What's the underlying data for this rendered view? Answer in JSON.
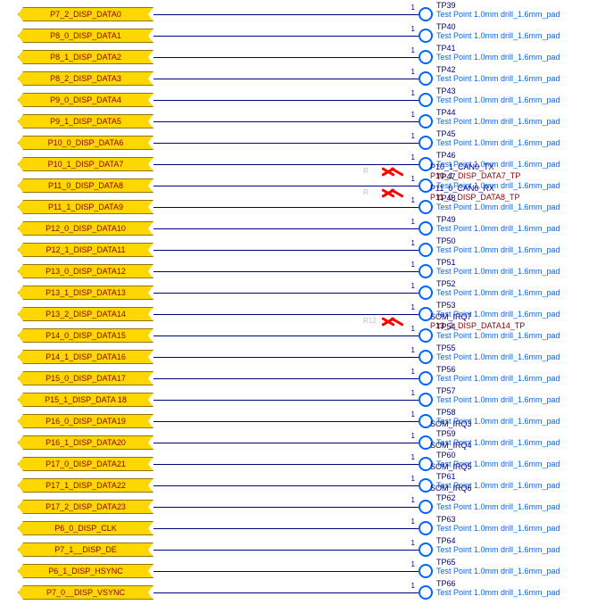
{
  "testpoint_desc": "Test Point 1.0mm drill_1.6mm_pad",
  "pin_label": "1",
  "rows": [
    {
      "port": "P7_2_DISP_DATA0",
      "tp": "TP39"
    },
    {
      "port": "P8_0_DISP_DATA1",
      "tp": "TP40"
    },
    {
      "port": "P8_1_DISP_DATA2",
      "tp": "TP41"
    },
    {
      "port": "P8_2_DISP_DATA3",
      "tp": "TP42"
    },
    {
      "port": "P9_0_DISP_DATA4",
      "tp": "TP43"
    },
    {
      "port": "P9_1_DISP_DATA5",
      "tp": "TP44"
    },
    {
      "port": "P10_0_DISP_DATA6",
      "tp": "TP45"
    },
    {
      "port": "P10_1_DISP_DATA7",
      "tp": "TP46",
      "dnp": true,
      "ref": "R",
      "mid_blue": "P10_1_CAN0_TX",
      "mid_red": "P10_1_DISP_DATA7_TP"
    },
    {
      "port": "P11_0_DISP_DATA8",
      "tp": "TP47",
      "dnp": true,
      "ref": "R",
      "mid_blue": "P11_0_CAN0_RX",
      "mid_red": "P11_0_DISP_DATA8_TP"
    },
    {
      "port": "P11_1_DISP_DATA9",
      "tp": "TP48"
    },
    {
      "port": "P12_0_DISP_DATA10",
      "tp": "TP49"
    },
    {
      "port": "P12_1_DISP_DATA11",
      "tp": "TP50"
    },
    {
      "port": "P13_0_DISP_DATA12",
      "tp": "TP51"
    },
    {
      "port": "P13_1_DISP_DATA13",
      "tp": "TP52"
    },
    {
      "port": "P13_2_DISP_DATA14",
      "tp": "TP53",
      "dnp": true,
      "ref": "R12",
      "mid_blue": "SOM_IRQ7",
      "mid_red": "P13_2_DISP_DATA14_TP"
    },
    {
      "port": "P14_0_DISP_DATA15",
      "tp": "TP54"
    },
    {
      "port": "P14_1_DISP_DATA16",
      "tp": "TP55"
    },
    {
      "port": "P15_0_DISP_DATA17",
      "tp": "TP56"
    },
    {
      "port": "P15_1_DISP_DATA 18",
      "tp": "TP57"
    },
    {
      "port": "P16_0_DISP_DATA19",
      "tp": "TP58",
      "mid_blue": "SOM_IRQ3"
    },
    {
      "port": "P16_1_DISP_DATA20",
      "tp": "TP59",
      "mid_blue": "SOM_IRQ4"
    },
    {
      "port": "P17_0_DISP_DATA21",
      "tp": "TP60",
      "mid_blue": "SOM_IRQ5"
    },
    {
      "port": "P17_1_DISP_DATA22",
      "tp": "TP61",
      "mid_blue": "SOM_IRQ6"
    },
    {
      "port": "P17_2_DISP_DATA23",
      "tp": "TP62"
    },
    {
      "port": "P6_0_DISP_CLK",
      "tp": "TP63"
    },
    {
      "port": "P7_1__DISP_DE",
      "tp": "TP64"
    },
    {
      "port": "P6_1_DISP_HSYNC",
      "tp": "TP65"
    },
    {
      "port": "P7_0__DISP_VSYNC",
      "tp": "TP66"
    }
  ]
}
